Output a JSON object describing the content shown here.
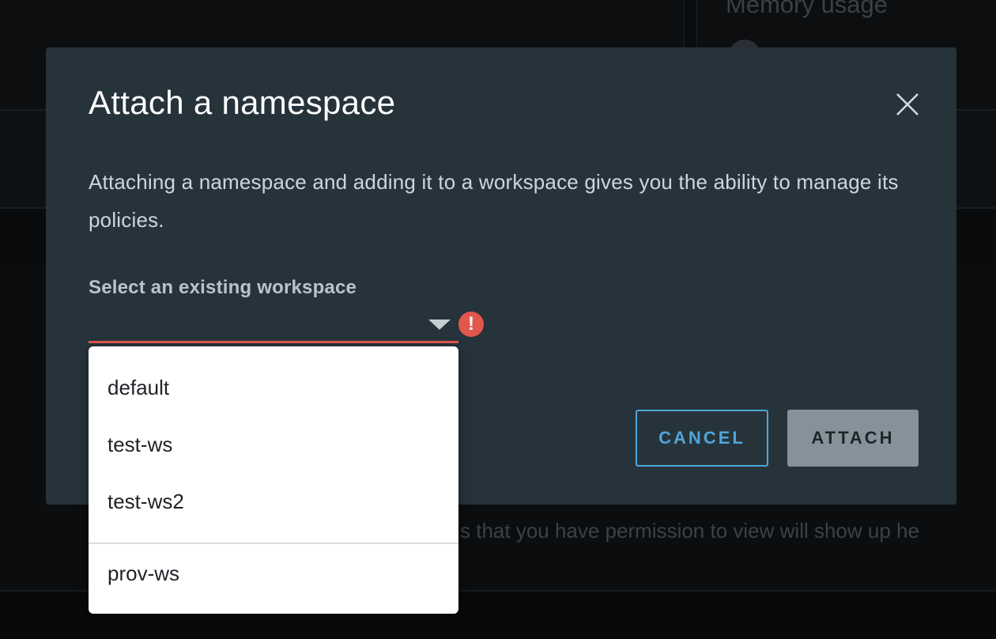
{
  "background": {
    "memory_title": "Memory usage",
    "hint_text": "s that you have permission to view will show up he"
  },
  "modal": {
    "title": "Attach a namespace",
    "description": "Attaching a namespace and adding it to a workspace gives you the ability to manage its policies.",
    "field_label": "Select an existing workspace",
    "selected_value": "",
    "error_glyph": "!",
    "cancel_label": "CANCEL",
    "attach_label": "ATTACH"
  },
  "dropdown": {
    "items": [
      {
        "label": "default"
      },
      {
        "label": "test-ws"
      },
      {
        "label": "test-ws2"
      }
    ],
    "separated_items": [
      {
        "label": "prov-ws"
      }
    ]
  },
  "colors": {
    "modal_bg": "#27333b",
    "error": "#e2574c",
    "accent": "#4fa6d8",
    "disabled_button": "#86929a"
  },
  "icons": [
    "close-icon",
    "chevron-down-icon",
    "error-icon"
  ]
}
